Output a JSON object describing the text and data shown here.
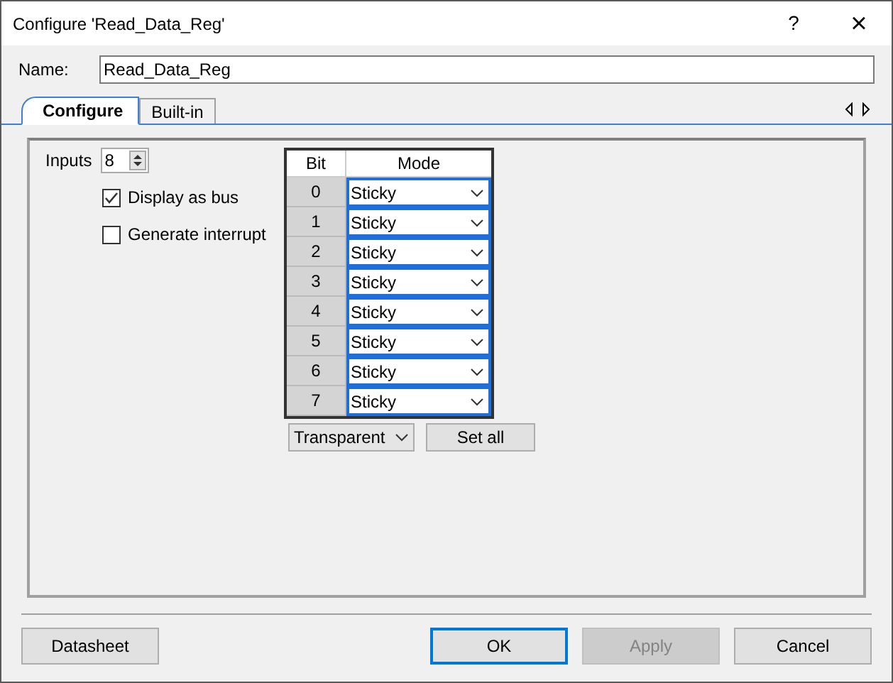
{
  "window": {
    "title": "Configure 'Read_Data_Reg'",
    "help": "?",
    "close": "×"
  },
  "name_field": {
    "label": "Name:",
    "value": "Read_Data_Reg"
  },
  "tabs": [
    {
      "label": "Configure",
      "selected": true
    },
    {
      "label": "Built-in",
      "selected": false
    }
  ],
  "inputs": {
    "label": "Inputs",
    "value": "8"
  },
  "checkboxes": [
    {
      "label": "Display as bus",
      "checked": true
    },
    {
      "label": "Generate interrupt",
      "checked": false
    }
  ],
  "table": {
    "columns": [
      "Bit",
      "Mode"
    ],
    "rows": [
      {
        "bit": "0",
        "mode": "Sticky"
      },
      {
        "bit": "1",
        "mode": "Sticky"
      },
      {
        "bit": "2",
        "mode": "Sticky"
      },
      {
        "bit": "3",
        "mode": "Sticky"
      },
      {
        "bit": "4",
        "mode": "Sticky"
      },
      {
        "bit": "5",
        "mode": "Sticky"
      },
      {
        "bit": "6",
        "mode": "Sticky"
      },
      {
        "bit": "7",
        "mode": "Sticky"
      }
    ]
  },
  "all_mode": {
    "value": "Transparent"
  },
  "set_all": "Set all",
  "buttons": [
    {
      "label": "Datasheet",
      "kind": "left",
      "disabled": false,
      "default": false
    },
    {
      "label": "OK",
      "kind": "right",
      "disabled": false,
      "default": true
    },
    {
      "label": "Apply",
      "kind": "right",
      "disabled": true,
      "default": false
    },
    {
      "label": "Cancel",
      "kind": "right",
      "disabled": false,
      "default": false
    }
  ]
}
